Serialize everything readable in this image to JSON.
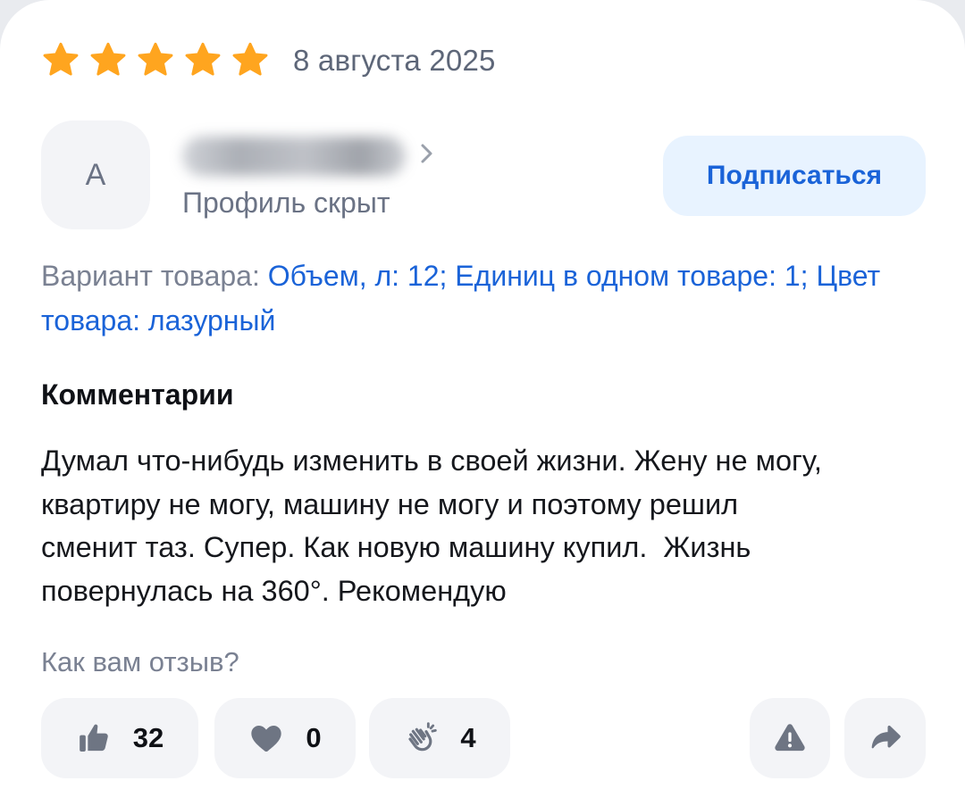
{
  "review": {
    "rating": 5,
    "rating_max": 5,
    "star_color": "#ffa51f",
    "date": "8 августа 2025",
    "author": {
      "avatar_letter": "А",
      "profile_status": "Профиль скрыт",
      "subscribe_label": "Подписаться"
    },
    "variant": {
      "label": "Вариант товара: ",
      "value": "Объем, л: 12; Единиц в одном товаре: 1; Цвет товара: лазурный"
    },
    "comments_heading": "Комментарии",
    "comment_text": "Думал что-нибудь изменить в своей жизни. Жену не могу,\nквартиру не могу, машину не могу и поэтому решил\nсменит таз. Супер. Как новую машину купил.  Жизнь\nповернулась на 360°. Рекомендую",
    "feedback_question": "Как вам отзыв?",
    "reactions": {
      "likes": "32",
      "hearts": "0",
      "claps": "4"
    },
    "icons": [
      "star-icon",
      "chevron-right-icon",
      "thumbs-up-icon",
      "heart-icon",
      "clapping-hands-icon",
      "warning-icon",
      "share-arrow-icon"
    ],
    "accent_color": "#1a63d8",
    "button_bg": "#f3f4f7",
    "icon_gray": "#6e7583"
  }
}
